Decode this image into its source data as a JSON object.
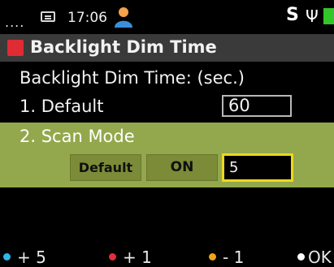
{
  "status_bar": {
    "dots": "....",
    "message_icon": "message-icon",
    "time": "17:06",
    "user_icon": "user-icon",
    "s_label": "S",
    "usb_symbol": "Ψ",
    "battery_color": "#33c52a"
  },
  "header": {
    "title": "Backlight Dim Time",
    "title_icon_color": "#e02b34"
  },
  "content": {
    "subtitle": "Backlight Dim Time: (sec.)",
    "items": [
      {
        "label": "1. Default",
        "value": "60"
      },
      {
        "label": "2. Scan Mode",
        "options": [
          "Default",
          "ON"
        ],
        "value": "5"
      }
    ]
  },
  "softkeys": [
    {
      "label": "+ 5",
      "color": "#2fb5e8"
    },
    {
      "label": "+ 1",
      "color": "#e0303a"
    },
    {
      "label": "- 1",
      "color": "#f0a21c"
    },
    {
      "label": "OK",
      "color": "#ffffff"
    }
  ],
  "colors": {
    "selection": "#93a84c",
    "focus_border": "#ecd81f"
  }
}
